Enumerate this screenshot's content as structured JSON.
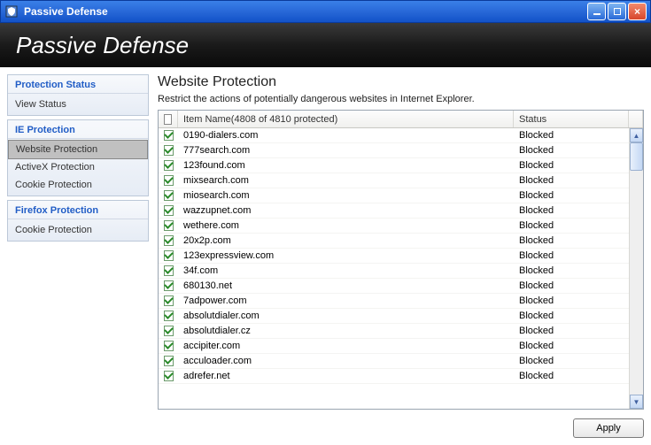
{
  "window": {
    "title": "Passive Defense"
  },
  "header": {
    "title": "Passive Defense"
  },
  "sidebar": {
    "groups": [
      {
        "title": "Protection Status",
        "items": [
          {
            "label": "View Status",
            "selected": false
          }
        ]
      },
      {
        "title": "IE Protection",
        "items": [
          {
            "label": "Website Protection",
            "selected": true
          },
          {
            "label": "ActiveX Protection",
            "selected": false
          },
          {
            "label": "Cookie Protection",
            "selected": false
          }
        ]
      },
      {
        "title": "Firefox Protection",
        "items": [
          {
            "label": "Cookie Protection",
            "selected": false
          }
        ]
      }
    ]
  },
  "main": {
    "title": "Website Protection",
    "description": "Restrict the actions of potentially dangerous websites in Internet Explorer.",
    "columns": {
      "name": "Item Name(4808 of 4810 protected)",
      "status": "Status"
    },
    "rows": [
      {
        "name": "0190-dialers.com",
        "status": "Blocked",
        "checked": true
      },
      {
        "name": "777search.com",
        "status": "Blocked",
        "checked": true
      },
      {
        "name": "123found.com",
        "status": "Blocked",
        "checked": true
      },
      {
        "name": "mixsearch.com",
        "status": "Blocked",
        "checked": true
      },
      {
        "name": "miosearch.com",
        "status": "Blocked",
        "checked": true
      },
      {
        "name": "wazzupnet.com",
        "status": "Blocked",
        "checked": true
      },
      {
        "name": "wethere.com",
        "status": "Blocked",
        "checked": true
      },
      {
        "name": "20x2p.com",
        "status": "Blocked",
        "checked": true
      },
      {
        "name": "123expressview.com",
        "status": "Blocked",
        "checked": true
      },
      {
        "name": "34f.com",
        "status": "Blocked",
        "checked": true
      },
      {
        "name": "680130.net",
        "status": "Blocked",
        "checked": true
      },
      {
        "name": "7adpower.com",
        "status": "Blocked",
        "checked": true
      },
      {
        "name": "absolutdialer.com",
        "status": "Blocked",
        "checked": true
      },
      {
        "name": "absolutdialer.cz",
        "status": "Blocked",
        "checked": true
      },
      {
        "name": "accipiter.com",
        "status": "Blocked",
        "checked": true
      },
      {
        "name": "acculoader.com",
        "status": "Blocked",
        "checked": true
      },
      {
        "name": "adrefer.net",
        "status": "Blocked",
        "checked": true
      }
    ],
    "apply_label": "Apply"
  }
}
